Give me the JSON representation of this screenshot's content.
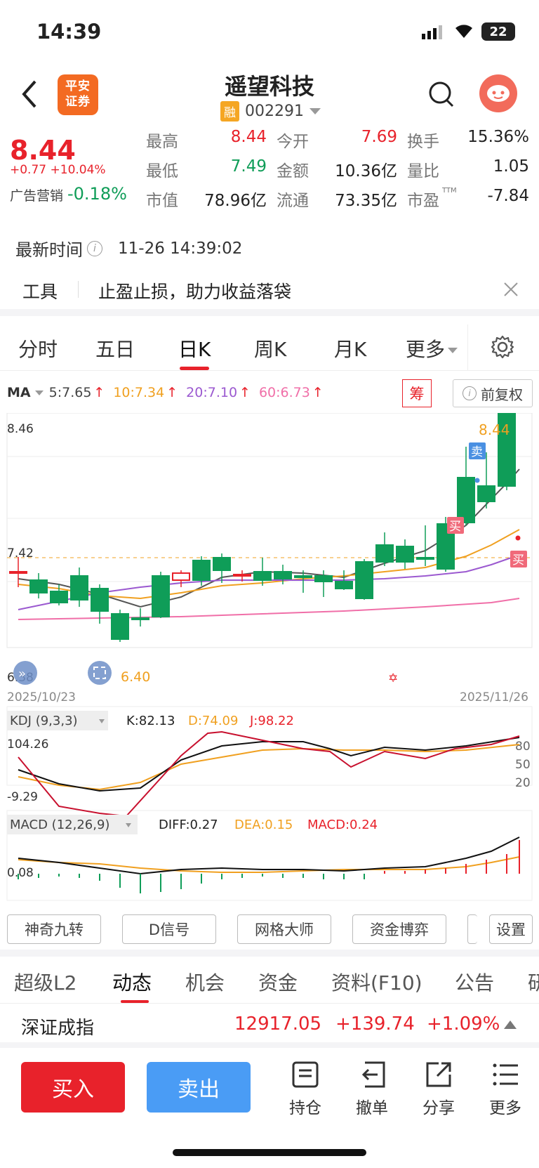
{
  "status": {
    "time": "14:39",
    "battery": "22"
  },
  "header": {
    "broker_logo": "平安证券",
    "stock_name": "遥望科技",
    "margin_badge": "融",
    "stock_code": "002291"
  },
  "quote": {
    "price": "8.44",
    "change": "+0.77",
    "change_pct": "+10.04%",
    "ad_label": "广告营销",
    "ad_pct": "-0.18%",
    "high_label": "最高",
    "high": "8.44",
    "low_label": "最低",
    "low": "7.49",
    "mcap_label": "市值",
    "mcap": "78.96亿",
    "open_label": "今开",
    "open": "7.69",
    "amount_label": "金额",
    "amount": "10.36亿",
    "float_label": "流通",
    "float": "73.35亿",
    "turnover_label": "换手",
    "turnover": "15.36%",
    "vr_label": "量比",
    "vr": "1.05",
    "pe_label": "市盈",
    "pe_sup": "TTM",
    "pe": "-7.84"
  },
  "update": {
    "label": "最新时间",
    "time": "11-26 14:39:02"
  },
  "tools": {
    "label": "工具",
    "text": "止盈止损，助力收益落袋"
  },
  "tabs": {
    "t1": "分时",
    "t2": "五日",
    "t3": "日K",
    "t4": "周K",
    "t5": "月K",
    "t6": "更多"
  },
  "ma": {
    "label": "MA",
    "ma5": "5:7.65",
    "ma10": "10:7.34",
    "ma20": "20:7.10",
    "ma60": "60:6.73",
    "chip_btn": "筹",
    "adjust_btn": "前复权"
  },
  "kchart": {
    "y_top": "8.46",
    "y_mid": "7.42",
    "y_bot": "6.38",
    "low_mark": "6.40",
    "high_mark": "8.44",
    "sell_tag": "卖",
    "buy_tag": "买",
    "date_start": "2025/10/23",
    "date_end": "2025/11/26"
  },
  "kdj": {
    "label": "KDJ (9,3,3)",
    "k": "K:82.13",
    "d": "D:74.09",
    "j": "J:98.22",
    "y_top": "104.26",
    "y_bot": "-9.29",
    "l80": "80",
    "l50": "50",
    "l20": "20"
  },
  "macd": {
    "label": "MACD (12,26,9)",
    "diff": "DIFF:0.27",
    "dea": "DEA:0.15",
    "macd": "MACD:0.24",
    "y_val": "0.08"
  },
  "chips": {
    "c1": "神奇九转",
    "c2": "D信号",
    "c3": "网格大师",
    "c4": "资金博弈",
    "c5": "设置"
  },
  "bottom_tabs": {
    "b1": "超级L2",
    "b2": "动态",
    "b3": "机会",
    "b4": "资金",
    "b5": "资料(F10)",
    "b6": "公告",
    "b7": "研"
  },
  "index": {
    "name": "深证成指",
    "value": "12917.05",
    "change": "+139.74",
    "pct": "+1.09%"
  },
  "actions": {
    "buy": "买入",
    "sell": "卖出",
    "hold": "持仓",
    "cancel": "撤单",
    "share": "分享",
    "more": "更多"
  },
  "colors": {
    "up": "#e8222b",
    "down": "#0f9d58",
    "buy_btn": "#e8222b",
    "sell_btn": "#4a9cf5",
    "ma5": "#555555",
    "ma10": "#f0a020",
    "ma20": "#9b59d0",
    "ma60": "#f06fa8"
  }
}
